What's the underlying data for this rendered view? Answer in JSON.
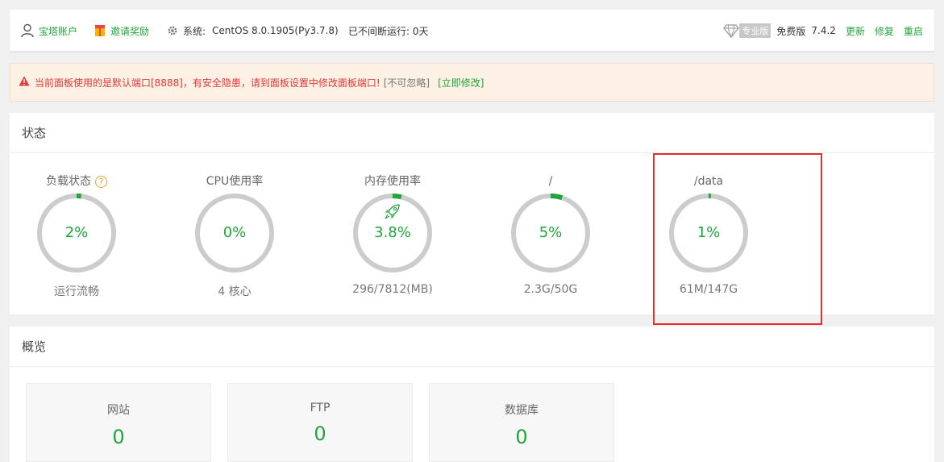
{
  "topbar": {
    "account": "宝塔账户",
    "invite": "邀请奖励",
    "system_label": "系统:",
    "system_value": "CentOS 8.0.1905(Py3.7.8)",
    "uptime": "已不间断运行: 0天",
    "pro_badge": "专业版",
    "edition": "免费版",
    "version": "7.4.2",
    "update": "更新",
    "repair": "修复",
    "restart": "重启"
  },
  "alert": {
    "message": "当前面板使用的是默认端口[8888]，有安全隐患，请到面板设置中修改面板端口!",
    "ignore": "[不可忽略]",
    "fix": "[立即修改]"
  },
  "status": {
    "title": "状态",
    "gauges": [
      {
        "title": "负载状态",
        "value": "2%",
        "percent": 2,
        "sub": "运行流畅"
      },
      {
        "title": "CPU使用率",
        "value": "0%",
        "percent": 0,
        "sub": "4 核心"
      },
      {
        "title": "内存使用率",
        "value": "3.8%",
        "percent": 3.8,
        "sub": "296/7812(MB)"
      },
      {
        "title": "/",
        "value": "5%",
        "percent": 5,
        "sub": "2.3G/50G"
      },
      {
        "title": "/data",
        "value": "1%",
        "percent": 1,
        "sub": "61M/147G"
      }
    ]
  },
  "overview": {
    "title": "概览",
    "cards": [
      {
        "label": "网站",
        "value": "0"
      },
      {
        "label": "FTP",
        "value": "0"
      },
      {
        "label": "数据库",
        "value": "0"
      }
    ]
  },
  "colors": {
    "accent": "#20a53a",
    "warning": "#e23838",
    "ring_track": "#cccccc",
    "highlight": "#e82a2a"
  }
}
